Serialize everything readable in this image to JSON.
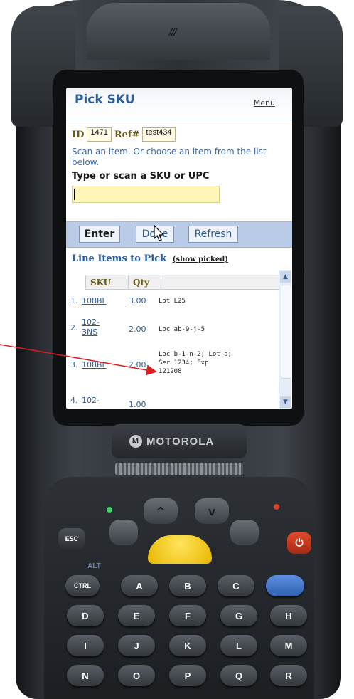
{
  "device": {
    "brand": "MOTOROLA",
    "brand_logo": "M",
    "speaker_mark": "///"
  },
  "app": {
    "title": "Pick SKU",
    "menu_label": "Menu",
    "id_label": "ID",
    "id_value": "1471",
    "ref_label": "Ref#",
    "ref_value": "test434",
    "instructions": "Scan an item. Or choose an item from the list below.",
    "sku_prompt": "Type or scan a SKU or UPC",
    "sku_input_value": "",
    "buttons": {
      "enter": "Enter",
      "done": "Done",
      "refresh": "Refresh"
    },
    "line_items_heading": "Line Items to Pick",
    "show_picked_label": "(show picked)",
    "columns": [
      "SKU",
      "Qty",
      ""
    ],
    "rows": [
      {
        "num": "1.",
        "sku": "108BL",
        "qty": "3.00",
        "loc": "Lot L25"
      },
      {
        "num": "2.",
        "sku_line1": "102-",
        "sku_line2": "3NS",
        "qty": "2.00",
        "loc": "Loc ab-9-j-5"
      },
      {
        "num": "3.",
        "sku": "108BL",
        "qty": "2.00",
        "loc_line1": "Loc b-1-n-2; Lot a;",
        "loc_line2": "Ser 1234; Exp",
        "loc_line3": "121208"
      },
      {
        "num": "4.",
        "sku": "102-",
        "qty": "1.00"
      }
    ]
  },
  "keys": {
    "esc": "ESC",
    "power": "⏻",
    "alt": "ALT",
    "ctrl": "CTRL",
    "row1": [
      "A",
      "B",
      "C"
    ],
    "row2": [
      "D",
      "E",
      "F",
      "G",
      "H"
    ],
    "row3": [
      "I",
      "J",
      "K",
      "L",
      "M"
    ],
    "row4": [
      "N",
      "O",
      "P",
      "Q",
      "R"
    ],
    "nav_up": "^",
    "nav_down": "v"
  },
  "colors": {
    "annotation_arrow": "#d81e1e",
    "scan_button": "#f2c400",
    "power_button": "#d23a1c"
  }
}
